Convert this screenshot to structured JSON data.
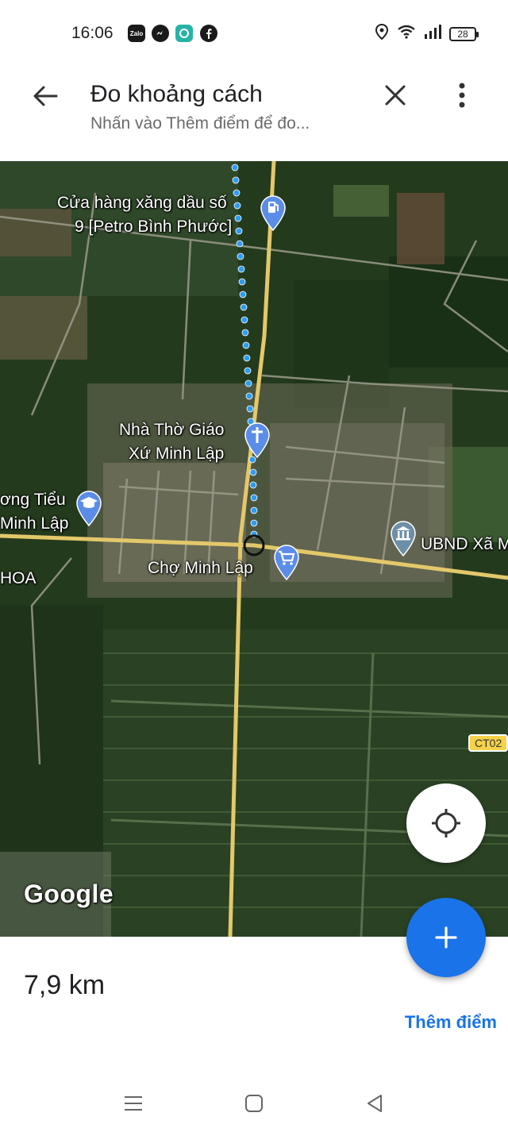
{
  "status_bar": {
    "time": "16:06",
    "apps": [
      "Zalo",
      "messenger-icon",
      "chat-icon",
      "facebook-icon"
    ],
    "battery": "28"
  },
  "header": {
    "title": "Đo khoảng cách",
    "subtitle": "Nhấn vào Thêm điểm để đo..."
  },
  "map": {
    "pois": {
      "gas_station_line1": "Cửa hàng xăng dầu số",
      "gas_station_line2": "9 [Petro Bình Phước]",
      "church_line1": "Nhà Thờ Giáo",
      "church_line2": "Xứ Minh Lập",
      "school_line1": "ơng Tiểu",
      "school_line2": "Minh Lập",
      "market": "Chợ Minh Lập",
      "committee": "UBND Xã M",
      "hoa": "HOA"
    },
    "road_shield": "CT02",
    "logo": "Google",
    "colors": {
      "route": "#2f9cf0",
      "pin": "#5b8de8",
      "road": "#e3c86a"
    }
  },
  "bottom_sheet": {
    "distance": "7,9 km",
    "add_point_label": "Thêm điểm"
  },
  "icons": {
    "back": "arrow-left-icon",
    "close": "close-icon",
    "more": "more-vert-icon",
    "locate": "my-location-icon",
    "add": "plus-icon"
  }
}
